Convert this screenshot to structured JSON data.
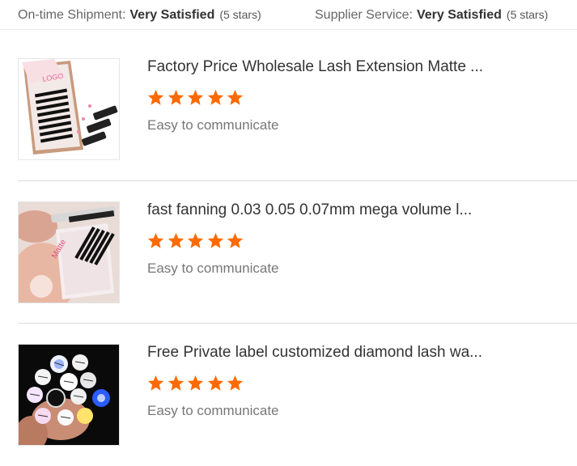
{
  "summary": {
    "shipment": {
      "label": "On-time Shipment:",
      "value": "Very Satisfied",
      "stars": "(5 stars)"
    },
    "service": {
      "label": "Supplier Service:",
      "value": "Very Satisfied",
      "stars": "(5 stars)"
    }
  },
  "reviews": [
    {
      "title": "Factory Price Wholesale Lash Extension Matte ...",
      "rating": 5,
      "comment": "Easy to communicate",
      "thumbnail_text": "LOGO",
      "thumbnail_icon": "lash-tray-pink-icon"
    },
    {
      "title": "fast fanning 0.03 0.05 0.07mm mega volume l...",
      "rating": 5,
      "comment": "Easy to communicate",
      "thumbnail_text": "Matte",
      "thumbnail_icon": "lash-tray-hand-icon"
    },
    {
      "title": "Free Private label customized diamond lash wa...",
      "rating": 5,
      "comment": "Easy to communicate",
      "thumbnail_text": "",
      "thumbnail_icon": "lash-wands-bouquet-icon"
    }
  ],
  "colors": {
    "star": "#ff6a00",
    "divider": "#dddddd"
  }
}
